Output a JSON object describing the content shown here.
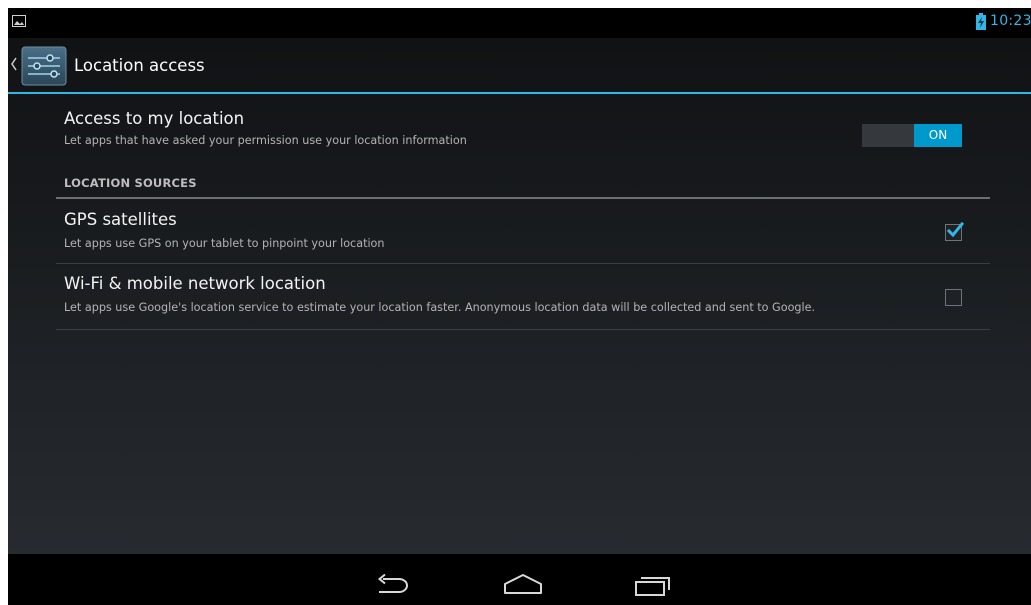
{
  "status_bar": {
    "time": "10:23",
    "accent_color": "#33b5e5",
    "icons": [
      "gallery-icon",
      "battery-charging-icon"
    ]
  },
  "action_bar": {
    "title": "Location access",
    "icons": [
      "up-caret-icon",
      "settings-sliders-icon"
    ]
  },
  "access": {
    "title": "Access to my location",
    "summary": "Let apps that have asked your permission use your location information",
    "toggle_label": "ON",
    "toggle_on": true
  },
  "sources": {
    "header": "LOCATION SOURCES",
    "items": [
      {
        "title": "GPS satellites",
        "summary": "Let apps use GPS on your tablet to pinpoint your location",
        "checked": true
      },
      {
        "title": "Wi-Fi & mobile network location",
        "summary": "Let apps use Google's location service to estimate your location faster. Anonymous location data will be collected and sent to Google.",
        "checked": false
      }
    ]
  },
  "nav_bar": {
    "icons": [
      "back-icon",
      "home-icon",
      "recents-icon"
    ]
  }
}
